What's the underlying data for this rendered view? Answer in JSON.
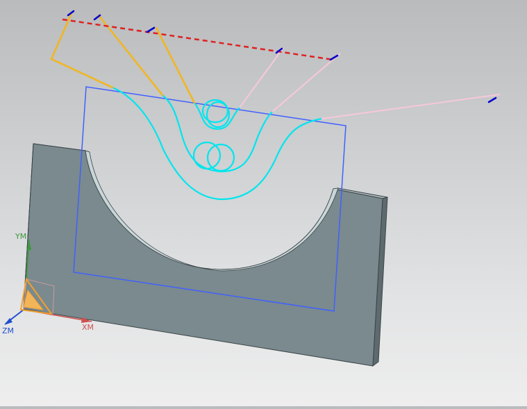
{
  "viewport": {
    "background_top": "#b9bbbd",
    "background_bottom": "#eeeeee"
  },
  "axes": {
    "y_label": "YM",
    "x_label": "XM",
    "z_label": "ZM",
    "y_color": "#3a9a3a",
    "x_color": "#d05050",
    "z_color": "#2050d0"
  },
  "colors": {
    "part_face": "#7a8a8e",
    "part_edge": "#3a4448",
    "arc_face": "#c9d6d8",
    "sketch_plane": "#4060ff",
    "toolpath": "#00e5ee",
    "tool_yellow": "#f2b61d",
    "dashed_red": "#e02020",
    "pink_line": "#f4c8d8",
    "marker_blue": "#0000cc"
  }
}
